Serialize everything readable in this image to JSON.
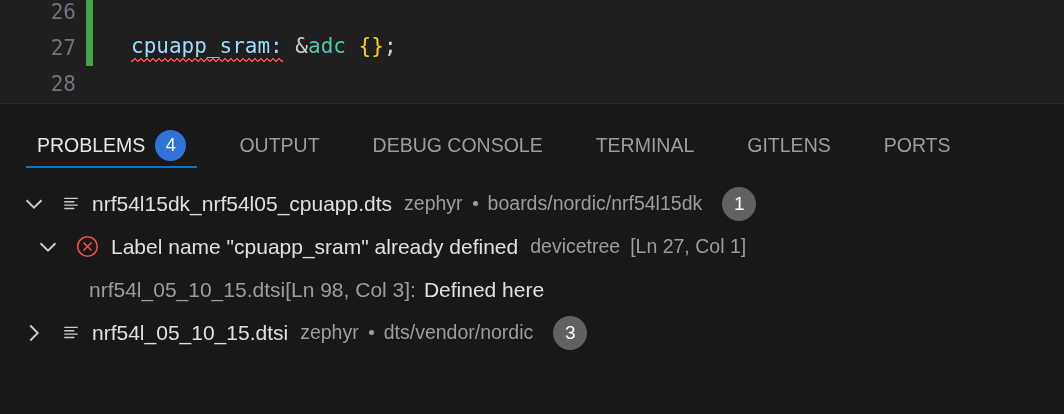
{
  "editor": {
    "lines": [
      {
        "number": "26",
        "modified": true
      },
      {
        "number": "27",
        "modified": true,
        "tokens": [
          {
            "text": "cpuapp_sram:",
            "kind": "label",
            "error": true
          },
          {
            "text": " &",
            "kind": "punct",
            "error": false
          },
          {
            "text": "adc",
            "kind": "ref",
            "error": false
          },
          {
            "text": " {}",
            "kind": "brace",
            "error": false
          },
          {
            "text": ";",
            "kind": "punct",
            "error": false
          }
        ]
      },
      {
        "number": "28",
        "modified": false
      }
    ]
  },
  "panel": {
    "tabs": [
      {
        "label": "PROBLEMS",
        "badge": "4",
        "selected": true
      },
      {
        "label": "OUTPUT",
        "selected": false
      },
      {
        "label": "DEBUG CONSOLE",
        "selected": false
      },
      {
        "label": "TERMINAL",
        "selected": false
      },
      {
        "label": "GITLENS",
        "selected": false
      },
      {
        "label": "PORTS",
        "selected": false
      }
    ],
    "files": [
      {
        "name": "nrf54l15dk_nrf54l05_cpuapp.dts",
        "folder": "zephyr",
        "path": "boards/nordic/nrf54l15dk",
        "count": "1",
        "expanded": true,
        "children": [
          {
            "message": "Label name \"cpuapp_sram\" already defined",
            "source": "devicetree",
            "location": "[Ln 27, Col 1]",
            "expanded": true,
            "children": [
              {
                "location": "nrf54l_05_10_15.dtsi[Ln 98, Col 3]:",
                "message": "Defined here"
              }
            ]
          }
        ]
      },
      {
        "name": "nrf54l_05_10_15.dtsi",
        "folder": "zephyr",
        "path": "dts/vendor/nordic",
        "count": "3",
        "expanded": false
      }
    ]
  }
}
